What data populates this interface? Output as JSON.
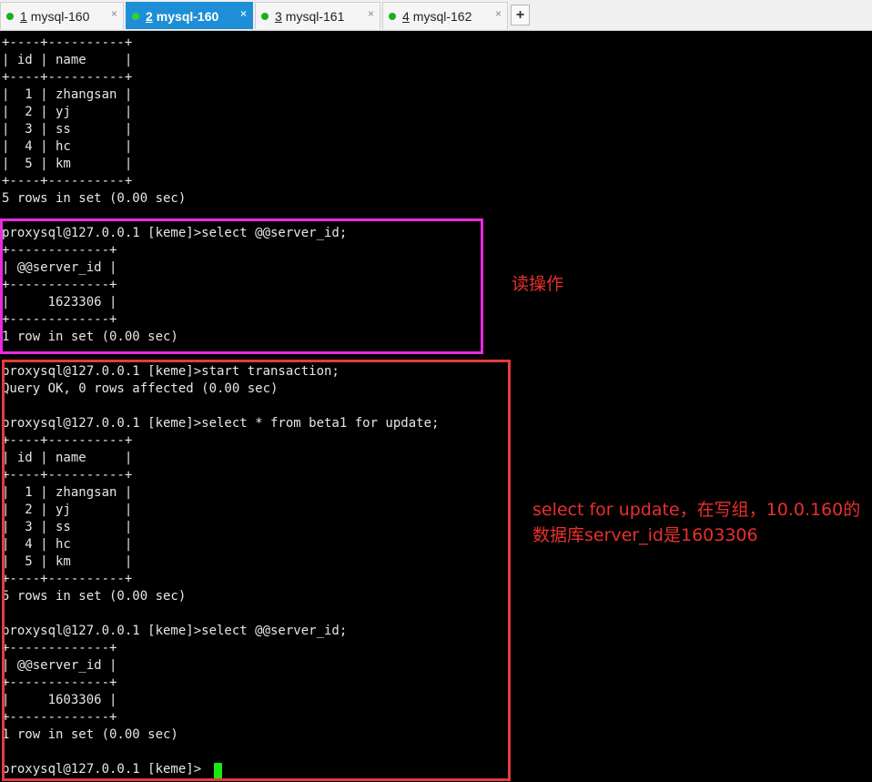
{
  "tabs": [
    {
      "num": "1",
      "label": " mysql-160",
      "active": false
    },
    {
      "num": "2",
      "label": " mysql-160",
      "active": true
    },
    {
      "num": "3",
      "label": " mysql-161",
      "active": false
    },
    {
      "num": "4",
      "label": " mysql-162",
      "active": false
    }
  ],
  "tab_close_glyph": "×",
  "add_tab_glyph": "+",
  "terminal": {
    "lines": [
      "+----+----------+",
      "| id | name     |",
      "+----+----------+",
      "|  1 | zhangsan |",
      "|  2 | yj       |",
      "|  3 | ss       |",
      "|  4 | hc       |",
      "|  5 | km       |",
      "+----+----------+",
      "5 rows in set (0.00 sec)",
      "",
      "proxysql@127.0.0.1 [keme]>select @@server_id;",
      "+-------------+",
      "| @@server_id |",
      "+-------------+",
      "|     1623306 |",
      "+-------------+",
      "1 row in set (0.00 sec)",
      "",
      "proxysql@127.0.0.1 [keme]>start transaction;",
      "Query OK, 0 rows affected (0.00 sec)",
      "",
      "proxysql@127.0.0.1 [keme]>select * from beta1 for update;",
      "+----+----------+",
      "| id | name     |",
      "+----+----------+",
      "|  1 | zhangsan |",
      "|  2 | yj       |",
      "|  3 | ss       |",
      "|  4 | hc       |",
      "|  5 | km       |",
      "+----+----------+",
      "5 rows in set (0.00 sec)",
      "",
      "proxysql@127.0.0.1 [keme]>select @@server_id;",
      "+-------------+",
      "| @@server_id |",
      "+-------------+",
      "|     1603306 |",
      "+-------------+",
      "1 row in set (0.00 sec)",
      "",
      "proxysql@127.0.0.1 [keme]>"
    ]
  },
  "annotations": {
    "read": "读操作",
    "write_line1": "select for update，在写组，10.0.160的",
    "write_line2": "数据库server_id是1603306"
  },
  "colors": {
    "terminal_bg": "#000000",
    "terminal_fg": "#e6e6e6",
    "cursor": "#18e818",
    "active_tab": "#1e8fd6",
    "pink_box": "#ea2ae0",
    "red_box": "#e63b3b",
    "annotation_text": "#e8302c"
  }
}
